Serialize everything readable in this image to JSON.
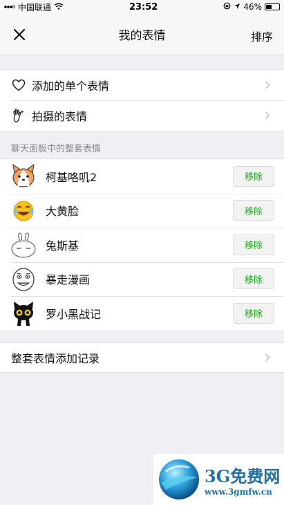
{
  "status_bar": {
    "carrier": "中国联通",
    "time": "23:52",
    "battery": "46%",
    "battery_level": 0.46
  },
  "nav": {
    "title": "我的表情",
    "sort_label": "排序"
  },
  "top_menu": [
    {
      "label": "添加的单个表情",
      "icon": "heart-icon"
    },
    {
      "label": "拍摄的表情",
      "icon": "hand-sparkle-icon"
    }
  ],
  "section_title": "聊天面板中的整套表情",
  "packs": [
    {
      "name": "柯基咯叽2",
      "action": "移除",
      "icon": "corgi-sticker-icon"
    },
    {
      "name": "大黄脸",
      "action": "移除",
      "icon": "laughing-emoji-icon"
    },
    {
      "name": "兔斯基",
      "action": "移除",
      "icon": "rabbit-sticker-icon"
    },
    {
      "name": "暴走漫画",
      "action": "移除",
      "icon": "rage-face-icon"
    },
    {
      "name": "罗小黑战记",
      "action": "移除",
      "icon": "black-cat-icon"
    }
  ],
  "record_label": "整套表情添加记录",
  "watermark": {
    "title": "3G免费网",
    "url": "www.3gmfw.cn"
  },
  "colors": {
    "accent_green": "#1aad19",
    "background": "#efeff4"
  }
}
